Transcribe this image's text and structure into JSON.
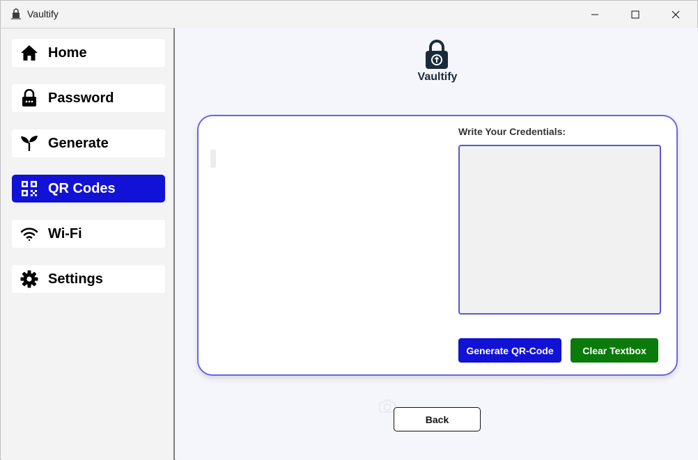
{
  "window": {
    "title": "Vaultify"
  },
  "sidebar": {
    "items": [
      {
        "label": "Home",
        "icon": "home-icon"
      },
      {
        "label": "Password",
        "icon": "lock-icon"
      },
      {
        "label": "Generate",
        "icon": "sprout-icon"
      },
      {
        "label": "QR Codes",
        "icon": "qr-code-icon",
        "active": true
      },
      {
        "label": "Wi-Fi",
        "icon": "wifi-icon"
      },
      {
        "label": "Settings",
        "icon": "gear-icon"
      }
    ]
  },
  "main": {
    "logo_text": "Vaultify",
    "credentials_label": "Write Your Credentials:",
    "credentials_value": "",
    "generate_label": "Generate QR-Code",
    "clear_label": "Clear Textbox",
    "back_label": "Back"
  },
  "colors": {
    "accent_blue": "#1212d6",
    "accent_green": "#0a7a0a",
    "card_border": "#6b63e6"
  }
}
